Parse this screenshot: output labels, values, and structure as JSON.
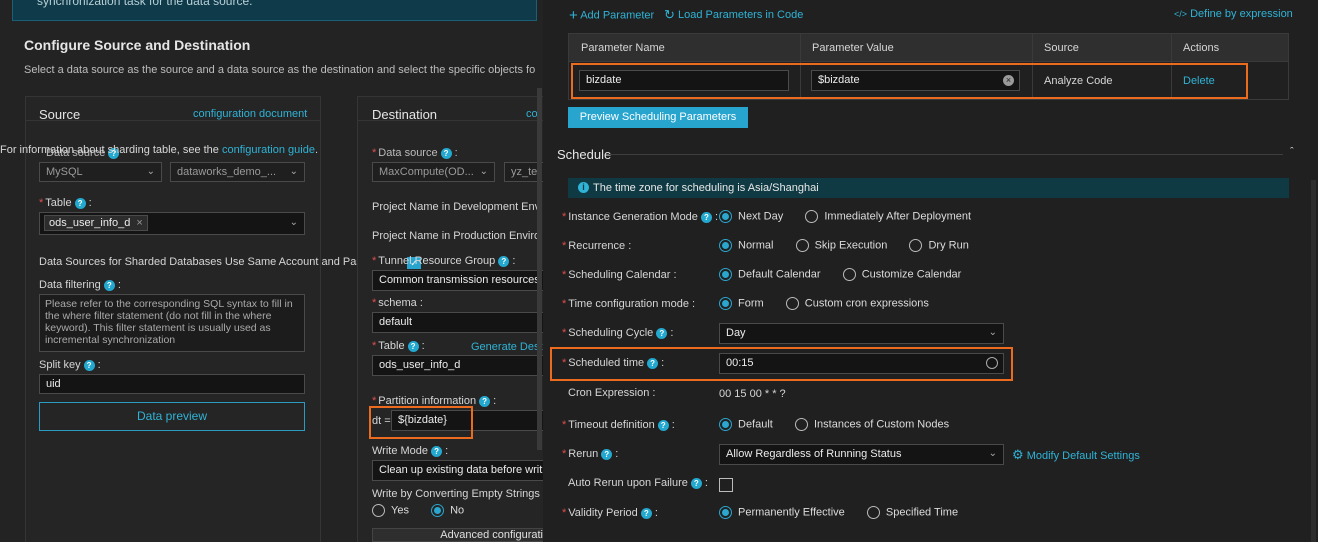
{
  "left": {
    "banner_text": "synchronization task for the data source.",
    "section_title": "Configure Source and Destination",
    "section_desc": "Select a data source as the source and a data source as the destination and select the specific objects for dat",
    "source": {
      "title": "Source",
      "config_link": "configuration document",
      "sharding_note": "For information about sharding table, see the",
      "sharding_link": "configuration guide",
      "sharding_dot": ".",
      "data_source_label": "Data source",
      "data_source_type": "MySQL",
      "data_source_name": "dataworks_demo_...",
      "table_label": "Table",
      "table_tag": "ods_user_info_d",
      "sharded_text": "Data Sources for Sharded Databases Use Same Account and Passw",
      "filtering_label": "Data filtering",
      "filtering_placeholder": "Please refer to the corresponding SQL syntax to fill in the where filter statement (do not fill in the where keyword). This filter statement is usually used as incremental synchronization",
      "split_key_label": "Split key",
      "split_key_value": "uid",
      "preview_button": "Data preview"
    },
    "destination": {
      "title": "Destination",
      "config_link": "co",
      "data_source_label": "Data source",
      "data_source_type": "MaxCompute(OD...",
      "data_source_name": "yz_te",
      "project_dev": "Project Name in Development Envir",
      "project_prod": "Project Name in Production Enviro",
      "tunnel_label": "Tunnel Resource Group",
      "tunnel_value": "Common transmission resources",
      "schema_label": "schema",
      "schema_value": "default",
      "table_label": "Table",
      "generate_link": "Generate Dest",
      "table_value": "ods_user_info_d",
      "partition_label": "Partition information",
      "partition_prefix": "dt =",
      "partition_value": "${bizdate}",
      "write_mode_label": "Write Mode",
      "write_mode_value": "Clean up existing data before writ",
      "empty_strings_label": "Write by Converting Empty Strings",
      "yes_label": "Yes",
      "no_label": "No",
      "advanced_button": "Advanced configurati"
    }
  },
  "params": {
    "add_param": "Add Parameter",
    "load_params": "Load Parameters in Code",
    "define_expr": "Define by expression",
    "headers": [
      "Parameter Name",
      "Parameter Value",
      "Source",
      "Actions"
    ],
    "row": {
      "name": "bizdate",
      "value": "$bizdate",
      "source": "Analyze Code",
      "action": "Delete"
    },
    "preview_button": "Preview Scheduling Parameters"
  },
  "schedule": {
    "title": "Schedule",
    "timezone_note": "The time zone for scheduling is Asia/Shanghai",
    "instance_gen": {
      "label": "Instance Generation Mode",
      "opt1": "Next Day",
      "opt2": "Immediately After Deployment"
    },
    "recurrence": {
      "label": "Recurrence",
      "opt1": "Normal",
      "opt2": "Skip Execution",
      "opt3": "Dry Run"
    },
    "calendar": {
      "label": "Scheduling Calendar",
      "opt1": "Default Calendar",
      "opt2": "Customize Calendar"
    },
    "time_config": {
      "label": "Time configuration mode",
      "opt1": "Form",
      "opt2": "Custom cron expressions"
    },
    "cycle": {
      "label": "Scheduling Cycle",
      "value": "Day"
    },
    "sched_time": {
      "label": "Scheduled time",
      "value": "00:15"
    },
    "cron": {
      "label": "Cron Expression",
      "value": "00 15 00 * * ?"
    },
    "timeout": {
      "label": "Timeout definition",
      "opt1": "Default",
      "opt2": "Instances of Custom Nodes"
    },
    "rerun": {
      "label": "Rerun",
      "value": "Allow Regardless of Running Status",
      "modify": "Modify Default Settings"
    },
    "auto_rerun": {
      "label": "Auto Rerun upon Failure"
    },
    "validity": {
      "label": "Validity Period",
      "opt1": "Permanently Effective",
      "opt2": "Specified Time"
    }
  },
  "colors": {
    "accent": "#2fb3d6",
    "highlight": "#ec6b1e",
    "required": "#e24f4f"
  }
}
